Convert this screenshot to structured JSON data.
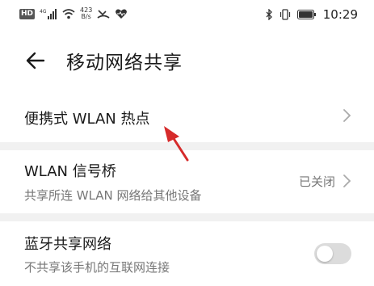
{
  "status_bar": {
    "network_badge": "HD",
    "network_type": "4G",
    "speed_value": "423",
    "speed_unit": "B/s",
    "time": "10:29"
  },
  "header": {
    "title": "移动网络共享",
    "back_icon": "arrow-left-icon"
  },
  "rows": [
    {
      "title": "便携式 WLAN 热点",
      "subtitle": "",
      "value": "",
      "control": "chevron"
    },
    {
      "title": "WLAN 信号桥",
      "subtitle": "共享所连 WLAN 网络给其他设备",
      "value": "已关闭",
      "control": "chevron"
    },
    {
      "title": "蓝牙共享网络",
      "subtitle": "不共享该手机的互联网连接",
      "value": "",
      "control": "toggle",
      "toggle_on": false
    }
  ],
  "colors": {
    "annotation_arrow": "#d62b2b",
    "toggle_off": "#dcdcdc",
    "background": "#f1f1f1"
  }
}
